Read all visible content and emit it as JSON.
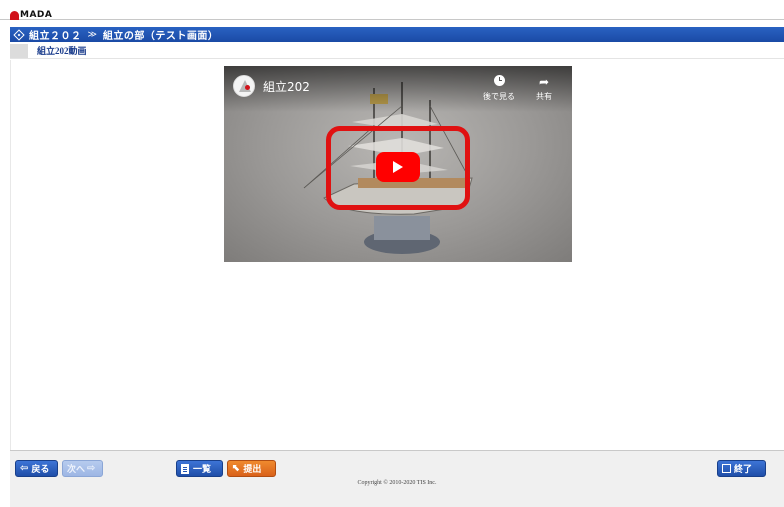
{
  "logo": {
    "text": "MADA"
  },
  "breadcrumb": {
    "course": "組立２０２",
    "separator": "≫",
    "section": "組立の部（テスト画面）"
  },
  "subtitle": "組立202動画",
  "video": {
    "title": "組立202",
    "watch_later_label": "後で見る",
    "share_label": "共有"
  },
  "footer": {
    "back_label": "戻る",
    "next_label": "次へ",
    "list_label": "一覧",
    "submit_label": "提出",
    "end_label": "終了",
    "copyright": "Copyright © 2010-2020 TIS Inc."
  },
  "colors": {
    "header_blue": "#1a4aa5",
    "accent_orange": "#d9611a",
    "play_red": "#ff0000"
  }
}
